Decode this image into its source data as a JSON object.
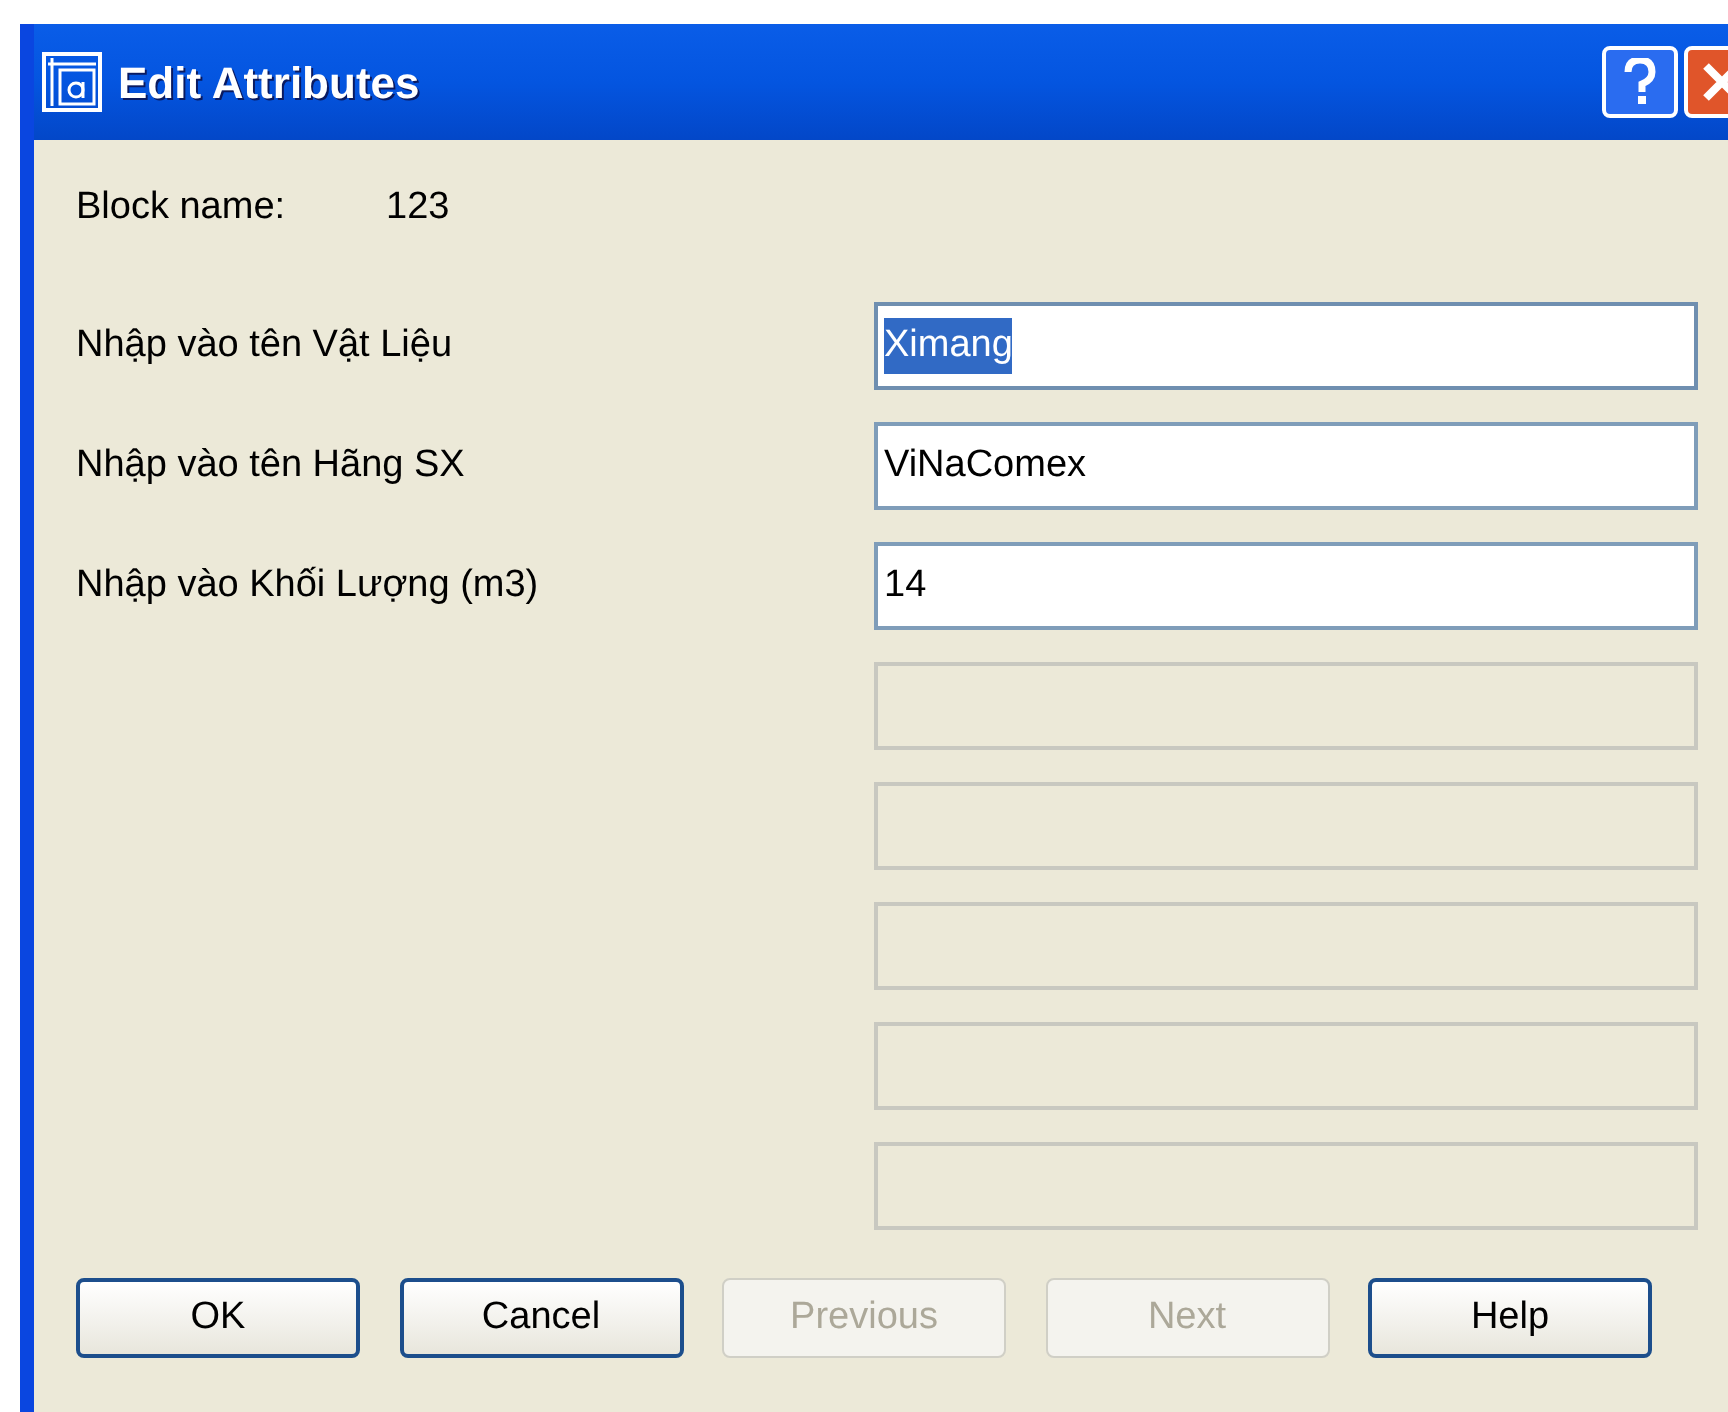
{
  "window": {
    "title": "Edit Attributes"
  },
  "block_name": {
    "label": "Block name:",
    "value": "123"
  },
  "attributes": [
    {
      "label": "Nhập vào tên Vật Liệu",
      "value": "Ximang",
      "selected": true,
      "disabled": false
    },
    {
      "label": "Nhập vào tên Hãng SX",
      "value": "ViNaComex",
      "selected": false,
      "disabled": false
    },
    {
      "label": "Nhập vào Khối Lượng (m3)",
      "value": "14",
      "selected": false,
      "disabled": false
    },
    {
      "selected": false,
      "disabled": true
    },
    {
      "selected": false,
      "disabled": true
    },
    {
      "selected": false,
      "disabled": true
    },
    {
      "selected": false,
      "disabled": true
    },
    {
      "selected": false,
      "disabled": true
    }
  ],
  "buttons": [
    {
      "label": "OK",
      "disabled": false
    },
    {
      "label": "Cancel",
      "disabled": false
    },
    {
      "label": "Previous",
      "disabled": true
    },
    {
      "label": "Next",
      "disabled": true
    },
    {
      "label": "Help",
      "disabled": false
    }
  ]
}
